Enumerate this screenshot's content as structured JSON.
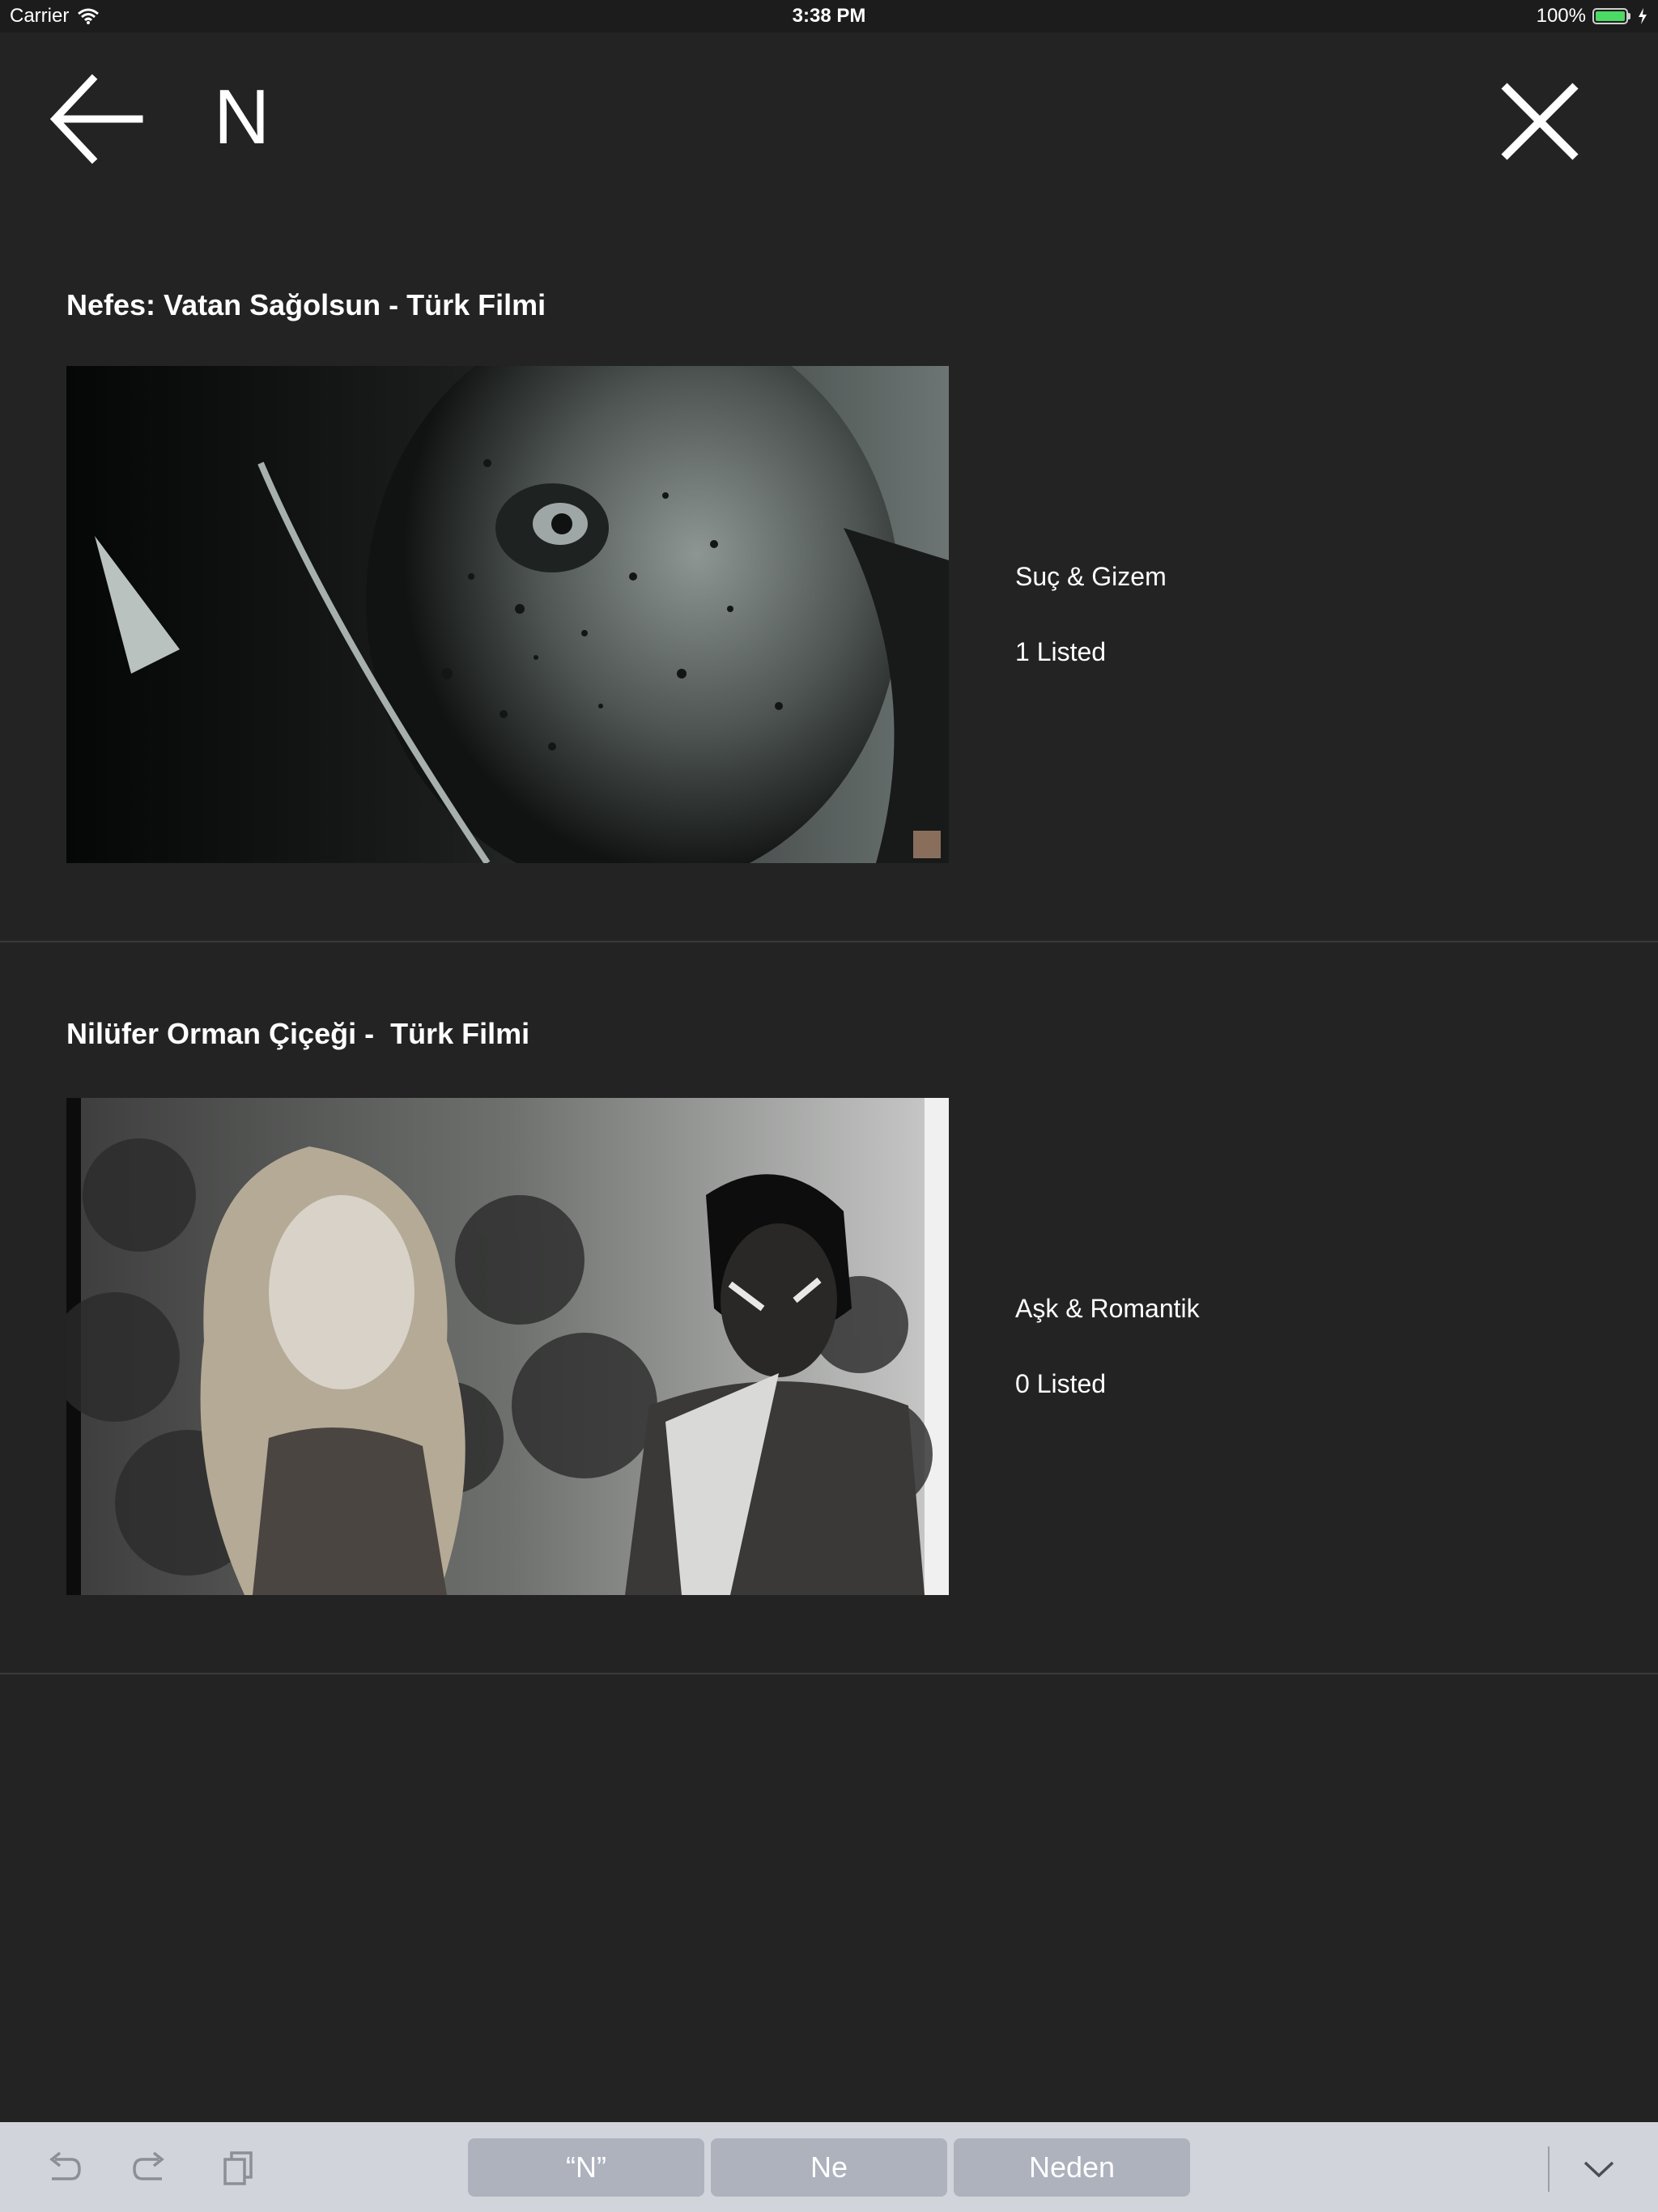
{
  "status_bar": {
    "carrier": "Carrier",
    "time": "3:38 PM",
    "battery_percent": "100%",
    "battery_level": 1.0
  },
  "search": {
    "query": "N",
    "back_icon": "arrow-left-icon",
    "close_icon": "close-x-icon"
  },
  "results": [
    {
      "title": "Nefes: Vatan Sağolsun - Türk Filmi",
      "genre": "Suç & Gizem",
      "listed": "1 Listed"
    },
    {
      "title": "Nilüfer Orman Çiçeği -  Türk Filmi",
      "genre": "Aşk & Romantik",
      "listed": "0 Listed"
    }
  ],
  "keyboard_bar": {
    "icons": [
      "undo-icon",
      "redo-icon",
      "paste-icon",
      "chevron-down-icon"
    ],
    "suggestions": [
      "“N”",
      "Ne",
      "Neden"
    ]
  },
  "colors": {
    "background": "#232324",
    "text": "#ffffff",
    "separator": "#3a3a3c",
    "keyboard_bar": "#d1d4db",
    "suggestion_bg": "#adb2bd",
    "battery_fill": "#4cd964"
  }
}
